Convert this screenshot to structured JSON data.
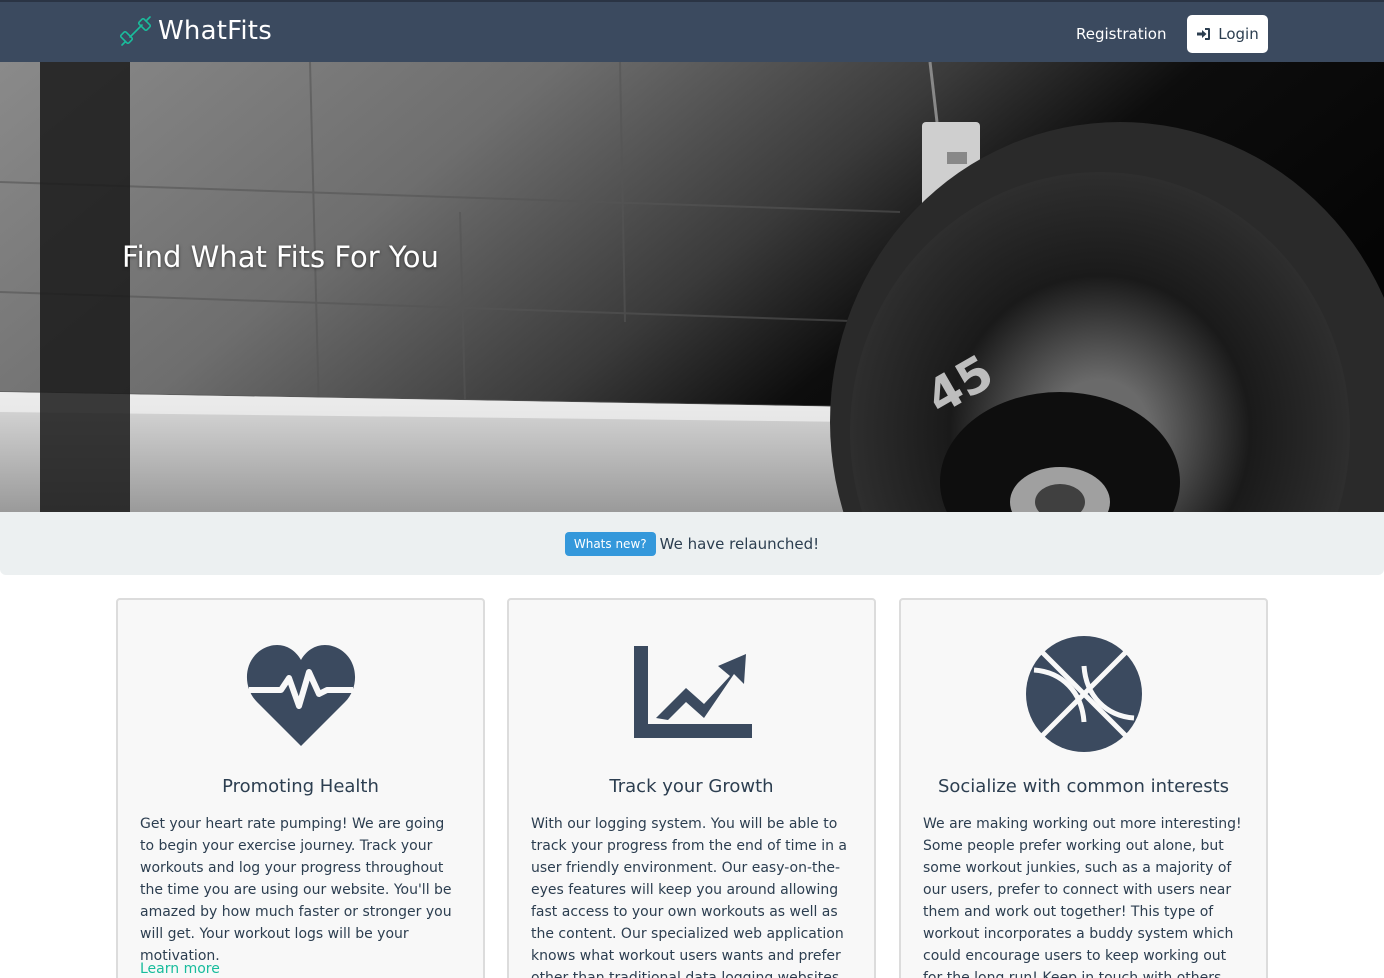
{
  "nav": {
    "brand": "WhatFits",
    "registration": "Registration",
    "login": "Login"
  },
  "hero": {
    "title": "Find What Fits For You"
  },
  "news": {
    "badge": "Whats new?",
    "text": "We have relaunched!"
  },
  "cards": [
    {
      "icon": "heartbeat-icon",
      "title": "Promoting Health",
      "text": "Get your heart rate pumping! We are going to begin your exercise journey. Track your workouts and log your progress throughout the time you are using our website. You'll be amazed by how much faster or stronger you will get. Your workout logs will be your motivation.",
      "link": "Learn more"
    },
    {
      "icon": "chart-line-icon",
      "title": "Track your Growth",
      "text": "With our logging system. You will be able to track your progress from the end of time in a user friendly environment. Our easy-on-the-eyes features will keep you around allowing fast access to your own workouts as well as the content. Our specialized web application knows what workout users wants and prefer other than traditional data logging websites."
    },
    {
      "icon": "basketball-icon",
      "title": "Socialize with common interests",
      "text": "We are making working out more interesting! Some people prefer working out alone, but some workout junkies, such as a majority of our users, prefer to connect with users near them and work out together! This type of workout incorporates a buddy system which could encourage users to keep working out for the long run! Keep in touch with others through our chat system and"
    }
  ],
  "colors": {
    "navbar": "#3b4a5f",
    "accent": "#18bc9c",
    "badge": "#3498db",
    "icon": "#3b4a5f"
  }
}
